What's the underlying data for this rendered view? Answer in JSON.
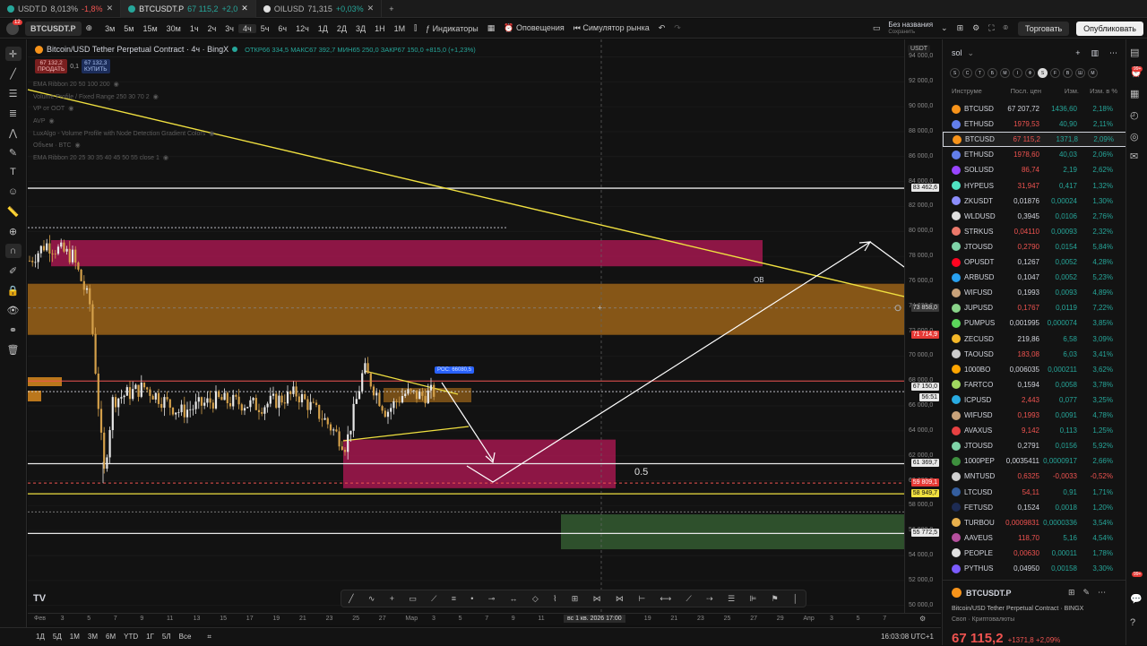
{
  "browser_tabs": [
    {
      "label": "USDT.D",
      "value": "8,013%",
      "change": "-1,8%",
      "dir": "dn",
      "active": false
    },
    {
      "label": "BTCUSDT.P",
      "value": "67 115,2",
      "change": "+2,0",
      "dir": "up",
      "active": true
    },
    {
      "label": "OILUSD",
      "value": "71,315",
      "change": "+0,03%",
      "dir": "up",
      "active": false
    }
  ],
  "toolbar": {
    "symbol": "BTCUSDT.P",
    "intervals": [
      "3м",
      "5м",
      "15м",
      "30м",
      "1ч",
      "2ч",
      "3ч",
      "4ч",
      "5ч",
      "6ч",
      "12ч",
      "1Д",
      "2Д",
      "3Д",
      "1Н",
      "1М"
    ],
    "active_interval": "4ч",
    "indicators_label": "Индикаторы",
    "alerts_label": "Оповещения",
    "replay_label": "Симулятор рынка",
    "layout_name": "Без названия",
    "layout_status": "Сохранить",
    "trade_label": "Торговать",
    "publish_label": "Опубликовать"
  },
  "legend": {
    "title": "Bitcoin/USD Tether Perpetual Contract · 4ч · BingX",
    "ohlc": "ОТКР66 334,5  МАКС67 392,7  МИН65 250,0  ЗАКР67 150,0  +815,0 (+1,23%)",
    "sell_price": "67 132,2",
    "sell_label": "ПРОДАТЬ",
    "spread": "0,1",
    "buy_price": "67 132,3",
    "buy_label": "КУПИТЬ",
    "indicators": [
      "EMA Ribbon 20 50 100 200",
      "Volume Profile / Fixed Range 250 30 70 2",
      "VP от ООТ",
      "AVP",
      "LuxAlgo - Volume Profile with Node Detection Gradient Colors",
      "Объем · BTC",
      "EMA Ribbon 20 25 30 35 40 45 50 55 close 1"
    ]
  },
  "chart_data": {
    "type": "candlestick",
    "currency": "USDT",
    "y_ticks": [
      "94 000,0",
      "92 000,0",
      "90 000,0",
      "88 000,0",
      "86 000,0",
      "84 000,0",
      "82 000,0",
      "80 000,0",
      "78 000,0",
      "76 000,0",
      "74 000,0",
      "72 000,0",
      "70 000,0",
      "68 000,0",
      "66 000,0",
      "64 000,0",
      "62 000,0",
      "60 000,0",
      "58 000,0",
      "56 000,0",
      "54 000,0",
      "52 000,0",
      "50 000,0"
    ],
    "ylim": [
      49400,
      95400
    ],
    "x_ticks": [
      "Фев",
      "3",
      "5",
      "7",
      "9",
      "11",
      "13",
      "15",
      "17",
      "19",
      "21",
      "23",
      "25",
      "27",
      "Мар",
      "3",
      "5",
      "7",
      "9",
      "11",
      "13",
      "15",
      "17",
      "19",
      "21",
      "23",
      "25",
      "27",
      "29",
      "Апр",
      "3",
      "5",
      "7"
    ],
    "price_labels": [
      {
        "value": "83 462,6",
        "style": "white"
      },
      {
        "value": "73 858,0",
        "style": "gray"
      },
      {
        "value": "71 714,9",
        "style": "red"
      },
      {
        "value": "67 150,0",
        "style": "white"
      },
      {
        "value": "56:51",
        "style": "white"
      },
      {
        "value": "61 369,7",
        "style": "white"
      },
      {
        "value": "59 809,1",
        "style": "red"
      },
      {
        "value": "58 949,7",
        "style": "yellow"
      },
      {
        "value": "55 772,5",
        "style": "white"
      }
    ],
    "annotations": {
      "ob": "OB",
      "fib": "0.5",
      "poc": "POC: 66080,5"
    },
    "crosshair_time": "вс 1 кв. 2026   17:00",
    "zones": [
      {
        "name": "supply-red",
        "from": 77200,
        "to": 79300,
        "color": "#c2185b"
      },
      {
        "name": "supply-orange",
        "from": 71700,
        "to": 75800,
        "color": "#b8741a"
      },
      {
        "name": "demand-red",
        "from": 59400,
        "to": 63300,
        "color": "#c2185b"
      },
      {
        "name": "demand-green",
        "from": 54500,
        "to": 57300,
        "color": "#3a6b38"
      }
    ],
    "hlines": [
      83462.6,
      61369.7,
      58949.7,
      55772.5
    ]
  },
  "timeframes_bottom": [
    "1Д",
    "5Д",
    "1М",
    "3М",
    "6М",
    "YTD",
    "1Г",
    "5Л",
    "Все"
  ],
  "clock": "16:03:08 UTC+1",
  "watchlist": {
    "name": "sol",
    "columns": [
      "Инструме",
      "Посл. цен",
      "Изм.",
      "Изм. в %"
    ],
    "rows": [
      {
        "sym": "BTCUSD",
        "last": "67 207,72",
        "chg": "1436,60",
        "pct": "2,18%",
        "dir": "up",
        "color": "#f7931a"
      },
      {
        "sym": "ETHUSD",
        "last": "1979,53",
        "chg": "40,90",
        "pct": "2,11%",
        "dir": "dn",
        "color": "#627eea"
      },
      {
        "sym": "BTCUSD",
        "last": "67 115,2",
        "chg": "1371,8",
        "pct": "2,09%",
        "dir": "dn",
        "color": "#f7931a"
      },
      {
        "sym": "ETHUSD",
        "last": "1978,60",
        "chg": "40,03",
        "pct": "2,06%",
        "dir": "dn",
        "color": "#627eea"
      },
      {
        "sym": "SOLUSD",
        "last": "86,74",
        "chg": "2,19",
        "pct": "2,62%",
        "dir": "dn",
        "color": "#9945ff"
      },
      {
        "sym": "HYPEUS",
        "last": "31,947",
        "chg": "0,417",
        "pct": "1,32%",
        "dir": "dn",
        "color": "#50e3c2"
      },
      {
        "sym": "ZKUSDT",
        "last": "0,01876",
        "chg": "0,00024",
        "pct": "1,30%",
        "dir": "up",
        "color": "#8c8dfc"
      },
      {
        "sym": "WLDUSD",
        "last": "0,3945",
        "chg": "0,0106",
        "pct": "2,76%",
        "dir": "up",
        "color": "#e0e0e0"
      },
      {
        "sym": "STRKUS",
        "last": "0,04110",
        "chg": "0,00093",
        "pct": "2,32%",
        "dir": "dn",
        "color": "#ec796b"
      },
      {
        "sym": "JTOUSD",
        "last": "0,2790",
        "chg": "0,0154",
        "pct": "5,84%",
        "dir": "dn",
        "color": "#7fd3a8"
      },
      {
        "sym": "OPUSDT",
        "last": "0,1267",
        "chg": "0,0052",
        "pct": "4,28%",
        "dir": "up",
        "color": "#ff0420"
      },
      {
        "sym": "ARBUSD",
        "last": "0,1047",
        "chg": "0,0052",
        "pct": "5,23%",
        "dir": "up",
        "color": "#28a0f0"
      },
      {
        "sym": "WIFUSD",
        "last": "0,1993",
        "chg": "0,0093",
        "pct": "4,89%",
        "dir": "up",
        "color": "#c8a27a"
      },
      {
        "sym": "JUPUSD",
        "last": "0,1767",
        "chg": "0,0119",
        "pct": "7,22%",
        "dir": "dn",
        "color": "#8ad48a"
      },
      {
        "sym": "PUMPUS",
        "last": "0,001995",
        "chg": "0,000074",
        "pct": "3,85%",
        "dir": "up",
        "color": "#5bd65b"
      },
      {
        "sym": "ZECUSD",
        "last": "219,86",
        "chg": "6,58",
        "pct": "3,09%",
        "dir": "up",
        "color": "#f4b728"
      },
      {
        "sym": "TAOUSD",
        "last": "183,08",
        "chg": "6,03",
        "pct": "3,41%",
        "dir": "dn",
        "color": "#cccccc"
      },
      {
        "sym": "1000BO",
        "last": "0,006035",
        "chg": "0,000211",
        "pct": "3,62%",
        "dir": "up",
        "color": "#ffa500"
      },
      {
        "sym": "FARTCO",
        "last": "0,1594",
        "chg": "0,0058",
        "pct": "3,78%",
        "dir": "up",
        "color": "#a0d860"
      },
      {
        "sym": "ICPUSD",
        "last": "2,443",
        "chg": "0,077",
        "pct": "3,25%",
        "dir": "dn",
        "color": "#29abe2"
      },
      {
        "sym": "WIFUSD",
        "last": "0,1993",
        "chg": "0,0091",
        "pct": "4,78%",
        "dir": "dn",
        "color": "#c8a27a"
      },
      {
        "sym": "AVAXUS",
        "last": "9,142",
        "chg": "0,113",
        "pct": "1,25%",
        "dir": "dn",
        "color": "#e84142"
      },
      {
        "sym": "JTOUSD",
        "last": "0,2791",
        "chg": "0,0156",
        "pct": "5,92%",
        "dir": "up",
        "color": "#7fd3a8"
      },
      {
        "sym": "1000PEP",
        "last": "0,0035411",
        "chg": "0,0000917",
        "pct": "2,66%",
        "dir": "up",
        "color": "#3d8f3d"
      },
      {
        "sym": "MNTUSD",
        "last": "0,6325",
        "chg": "-0,0033",
        "pct": "-0,52%",
        "dir": "dn",
        "color": "#d0d0d0"
      },
      {
        "sym": "LTCUSD",
        "last": "54,11",
        "chg": "0,91",
        "pct": "1,71%",
        "dir": "dn",
        "color": "#345d9d"
      },
      {
        "sym": "FETUSD",
        "last": "0,1524",
        "chg": "0,0018",
        "pct": "1,20%",
        "dir": "up",
        "color": "#1d2b53"
      },
      {
        "sym": "TURBOU",
        "last": "0,0009831",
        "chg": "0,0000336",
        "pct": "3,54%",
        "dir": "dn",
        "color": "#e8b04c"
      },
      {
        "sym": "AAVEUS",
        "last": "118,70",
        "chg": "5,16",
        "pct": "4,54%",
        "dir": "dn",
        "color": "#b6509e"
      },
      {
        "sym": "PEOPLE",
        "last": "0,00630",
        "chg": "0,00011",
        "pct": "1,78%",
        "dir": "dn",
        "color": "#e0e0e0"
      },
      {
        "sym": "PYTHUS",
        "last": "0,04950",
        "chg": "0,00158",
        "pct": "3,30%",
        "dir": "up",
        "color": "#7c5cff"
      }
    ]
  },
  "details": {
    "symbol": "BTCUSDT.P",
    "name": "Bitcoin/USD Tether Perpetual Contract",
    "exchange": "BINGX",
    "category": "Своп · Криптовалюты",
    "price": "67 115,2",
    "change": "+1371,8 +2,09%"
  },
  "badges": {
    "notifications": "12",
    "right_top": "99+",
    "right_bottom": "99+"
  }
}
